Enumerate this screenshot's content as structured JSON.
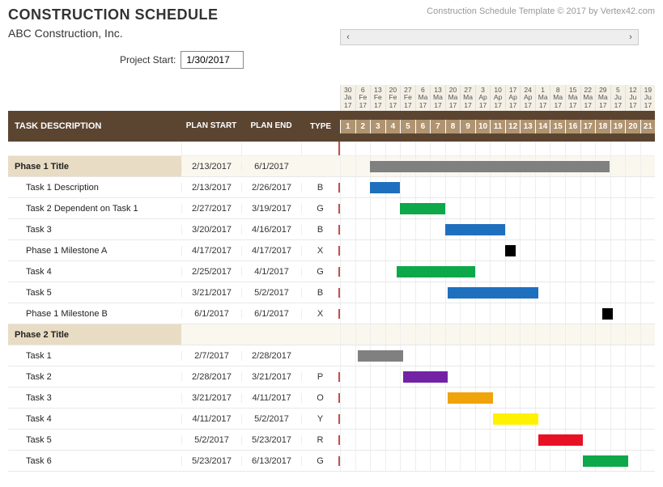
{
  "header": {
    "title": "CONSTRUCTION SCHEDULE",
    "company": "ABC Construction, Inc.",
    "credit": "Construction Schedule Template © 2017 by Vertex42.com",
    "project_start_label": "Project Start:",
    "project_start_value": "1/30/2017"
  },
  "columns": {
    "task": "TASK DESCRIPTION",
    "plan_start": "PLAN START",
    "plan_end": "PLAN END",
    "type": "TYPE"
  },
  "timeline": {
    "dates": [
      {
        "d": "30",
        "m": "Ja",
        "y": "17"
      },
      {
        "d": "6",
        "m": "Fe",
        "y": "17"
      },
      {
        "d": "13",
        "m": "Fe",
        "y": "17"
      },
      {
        "d": "20",
        "m": "Fe",
        "y": "17"
      },
      {
        "d": "27",
        "m": "Fe",
        "y": "17"
      },
      {
        "d": "6",
        "m": "Ma",
        "y": "17"
      },
      {
        "d": "13",
        "m": "Ma",
        "y": "17"
      },
      {
        "d": "20",
        "m": "Ma",
        "y": "17"
      },
      {
        "d": "27",
        "m": "Ma",
        "y": "17"
      },
      {
        "d": "3",
        "m": "Ap",
        "y": "17"
      },
      {
        "d": "10",
        "m": "Ap",
        "y": "17"
      },
      {
        "d": "17",
        "m": "Ap",
        "y": "17"
      },
      {
        "d": "24",
        "m": "Ap",
        "y": "17"
      },
      {
        "d": "1",
        "m": "Ma",
        "y": "17"
      },
      {
        "d": "8",
        "m": "Ma",
        "y": "17"
      },
      {
        "d": "15",
        "m": "Ma",
        "y": "17"
      },
      {
        "d": "22",
        "m": "Ma",
        "y": "17"
      },
      {
        "d": "29",
        "m": "Ma",
        "y": "17"
      },
      {
        "d": "5",
        "m": "Ju",
        "y": "17"
      },
      {
        "d": "12",
        "m": "Ju",
        "y": "17"
      },
      {
        "d": "19",
        "m": "Ju",
        "y": "17"
      }
    ],
    "weeks": [
      "1",
      "2",
      "3",
      "4",
      "5",
      "6",
      "7",
      "8",
      "9",
      "10",
      "11",
      "12",
      "13",
      "14",
      "15",
      "16",
      "17",
      "18",
      "19",
      "20",
      "21"
    ]
  },
  "rows": [
    {
      "phase": true,
      "task": "Phase 1 Title",
      "start": "2/13/2017",
      "end": "6/1/2017",
      "type": "",
      "bar_start": 2,
      "bar_span": 16,
      "color": "#808080"
    },
    {
      "task": "Task 1 Description",
      "start": "2/13/2017",
      "end": "2/26/2017",
      "type": "B",
      "bar_start": 2,
      "bar_span": 2,
      "color": "#1f6fbf"
    },
    {
      "task": "Task 2 Dependent on Task 1",
      "start": "2/27/2017",
      "end": "3/19/2017",
      "type": "G",
      "bar_start": 4,
      "bar_span": 3,
      "color": "#0ca84a"
    },
    {
      "task": "Task 3",
      "start": "3/20/2017",
      "end": "4/16/2017",
      "type": "B",
      "bar_start": 7,
      "bar_span": 4,
      "color": "#1f6fbf"
    },
    {
      "task": "Phase 1 Milestone A",
      "start": "4/17/2017",
      "end": "4/17/2017",
      "type": "X",
      "bar_start": 11,
      "bar_span": 0.7,
      "color": "#000000"
    },
    {
      "task": "Task 4",
      "start": "2/25/2017",
      "end": "4/1/2017",
      "type": "G",
      "bar_start": 3.8,
      "bar_span": 5.2,
      "color": "#0ca84a"
    },
    {
      "task": "Task 5",
      "start": "3/21/2017",
      "end": "5/2/2017",
      "type": "B",
      "bar_start": 7.2,
      "bar_span": 6,
      "color": "#1f6fbf"
    },
    {
      "task": "Phase 1 Milestone B",
      "start": "6/1/2017",
      "end": "6/1/2017",
      "type": "X",
      "bar_start": 17.5,
      "bar_span": 0.7,
      "color": "#000000"
    },
    {
      "phase": true,
      "task": "Phase 2 Title",
      "start": "",
      "end": "",
      "type": "",
      "bar_start": 0,
      "bar_span": 0,
      "color": ""
    },
    {
      "task": "Task 1",
      "start": "2/7/2017",
      "end": "2/28/2017",
      "type": "",
      "bar_start": 1.2,
      "bar_span": 3,
      "color": "#808080"
    },
    {
      "task": "Task 2",
      "start": "2/28/2017",
      "end": "3/21/2017",
      "type": "P",
      "bar_start": 4.2,
      "bar_span": 3,
      "color": "#7322a6"
    },
    {
      "task": "Task 3",
      "start": "3/21/2017",
      "end": "4/11/2017",
      "type": "O",
      "bar_start": 7.2,
      "bar_span": 3,
      "color": "#f0a30a"
    },
    {
      "task": "Task 4",
      "start": "4/11/2017",
      "end": "5/2/2017",
      "type": "Y",
      "bar_start": 10.2,
      "bar_span": 3,
      "color": "#fff200"
    },
    {
      "task": "Task 5",
      "start": "5/2/2017",
      "end": "5/23/2017",
      "type": "R",
      "bar_start": 13.2,
      "bar_span": 3,
      "color": "#e81123"
    },
    {
      "task": "Task 6",
      "start": "5/23/2017",
      "end": "6/13/2017",
      "type": "G",
      "bar_start": 16.2,
      "bar_span": 3,
      "color": "#0ca84a"
    }
  ],
  "chart_data": {
    "type": "gantt",
    "title": "Construction Schedule",
    "x_start": "2017-01-30",
    "x_end": "2017-06-25",
    "x_unit": "weeks",
    "tasks": [
      {
        "name": "Phase 1 Title",
        "start": "2017-02-13",
        "end": "2017-06-01",
        "category": "phase"
      },
      {
        "name": "Task 1 Description",
        "start": "2017-02-13",
        "end": "2017-02-26",
        "category": "B"
      },
      {
        "name": "Task 2 Dependent on Task 1",
        "start": "2017-02-27",
        "end": "2017-03-19",
        "category": "G"
      },
      {
        "name": "Task 3",
        "start": "2017-03-20",
        "end": "2017-04-16",
        "category": "B"
      },
      {
        "name": "Phase 1 Milestone A",
        "start": "2017-04-17",
        "end": "2017-04-17",
        "category": "X"
      },
      {
        "name": "Task 4",
        "start": "2017-02-25",
        "end": "2017-04-01",
        "category": "G"
      },
      {
        "name": "Task 5",
        "start": "2017-03-21",
        "end": "2017-05-02",
        "category": "B"
      },
      {
        "name": "Phase 1 Milestone B",
        "start": "2017-06-01",
        "end": "2017-06-01",
        "category": "X"
      },
      {
        "name": "Phase 2 Title",
        "start": "",
        "end": "",
        "category": "phase"
      },
      {
        "name": "Task 1",
        "start": "2017-02-07",
        "end": "2017-02-28",
        "category": ""
      },
      {
        "name": "Task 2",
        "start": "2017-02-28",
        "end": "2017-03-21",
        "category": "P"
      },
      {
        "name": "Task 3",
        "start": "2017-03-21",
        "end": "2017-04-11",
        "category": "O"
      },
      {
        "name": "Task 4",
        "start": "2017-04-11",
        "end": "2017-05-02",
        "category": "Y"
      },
      {
        "name": "Task 5",
        "start": "2017-05-02",
        "end": "2017-05-23",
        "category": "R"
      },
      {
        "name": "Task 6",
        "start": "2017-05-23",
        "end": "2017-06-13",
        "category": "G"
      }
    ],
    "color_map": {
      "B": "#1f6fbf",
      "G": "#0ca84a",
      "X": "#000000",
      "P": "#7322a6",
      "O": "#f0a30a",
      "Y": "#fff200",
      "R": "#e81123",
      "phase": "#808080",
      "": "#808080"
    }
  }
}
